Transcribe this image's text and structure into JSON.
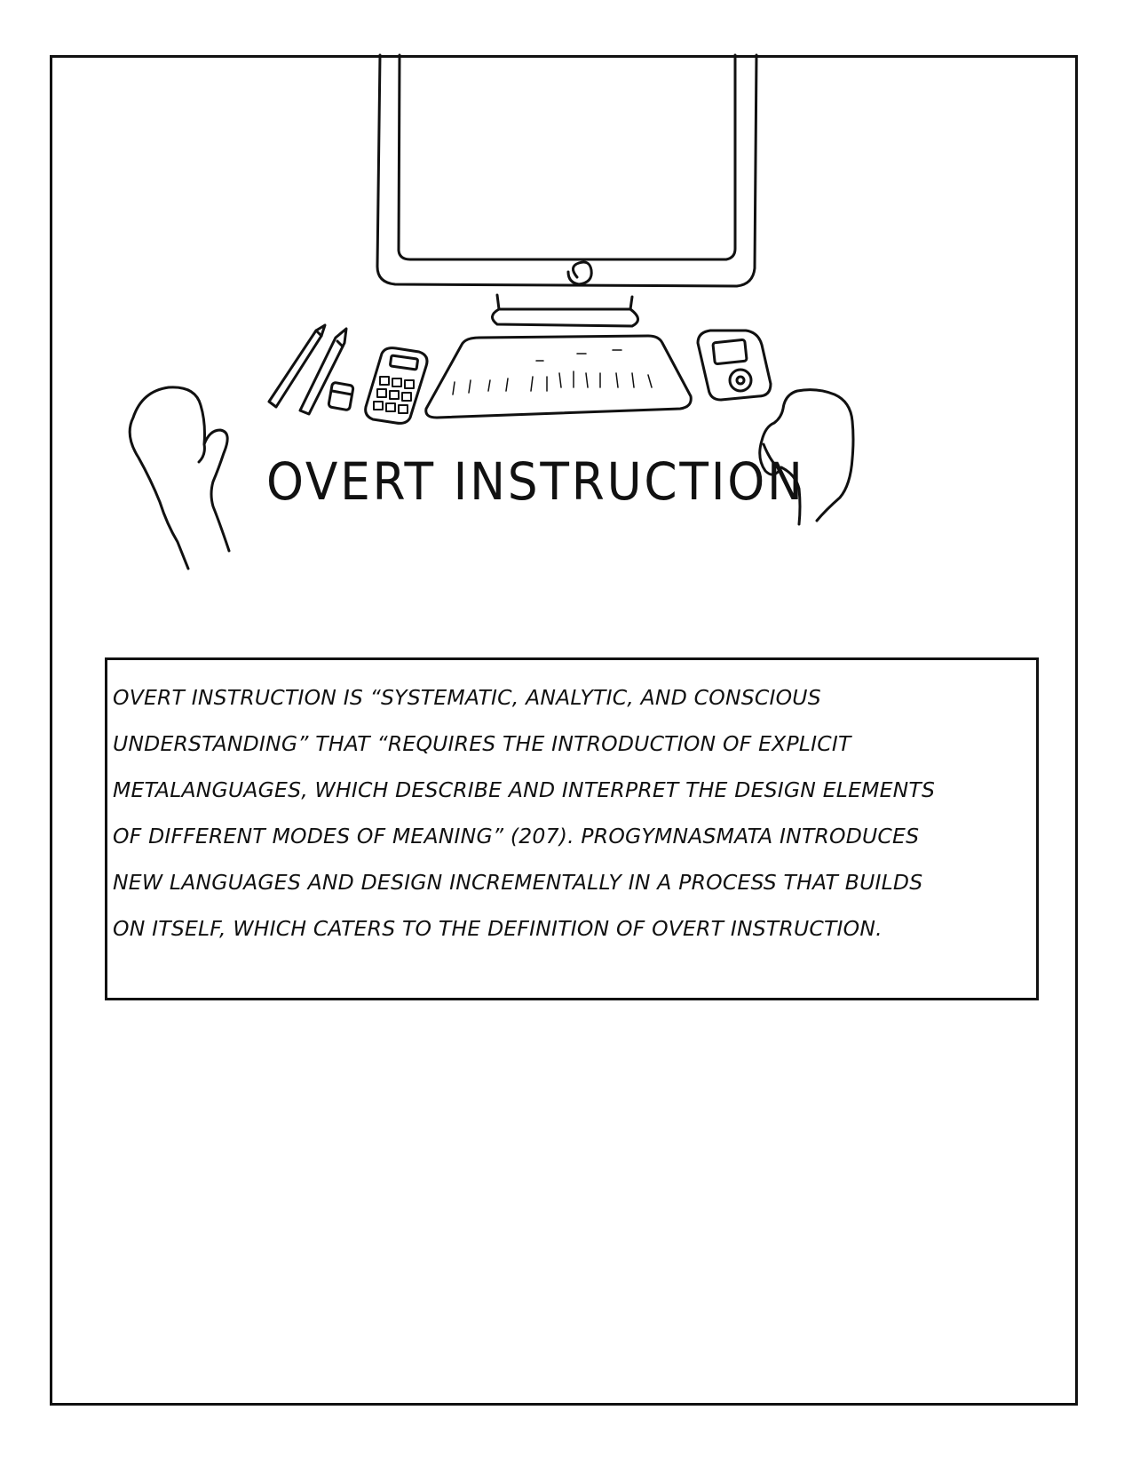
{
  "illustration": {
    "title": "OVERT INSTRUCTION",
    "items": [
      "computer-monitor",
      "pencil",
      "pen",
      "eraser",
      "calculator",
      "keyboard",
      "music-player",
      "left-hand",
      "right-hand"
    ]
  },
  "caption": {
    "lines": [
      "OVERT INSTRUCTION IS “SYSTEMATIC, ANALYTIC, AND CONSCIOUS",
      "UNDERSTANDING” THAT “REQUIRES THE INTRODUCTION OF EXPLICIT",
      "METALANGUAGES, WHICH DESCRIBE AND INTERPRET THE DESIGN ELEMENTS",
      "OF DIFFERENT MODES OF MEANING” (207). PROGYMNASMATA INTRODUCES",
      "NEW LANGUAGES AND DESIGN INCREMENTALLY IN A PROCESS THAT BUILDS",
      "ON ITSELF, WHICH CATERS TO THE DEFINITION OF OVERT INSTRUCTION."
    ]
  },
  "colors": {
    "ink": "#111111",
    "paper": "#ffffff"
  }
}
